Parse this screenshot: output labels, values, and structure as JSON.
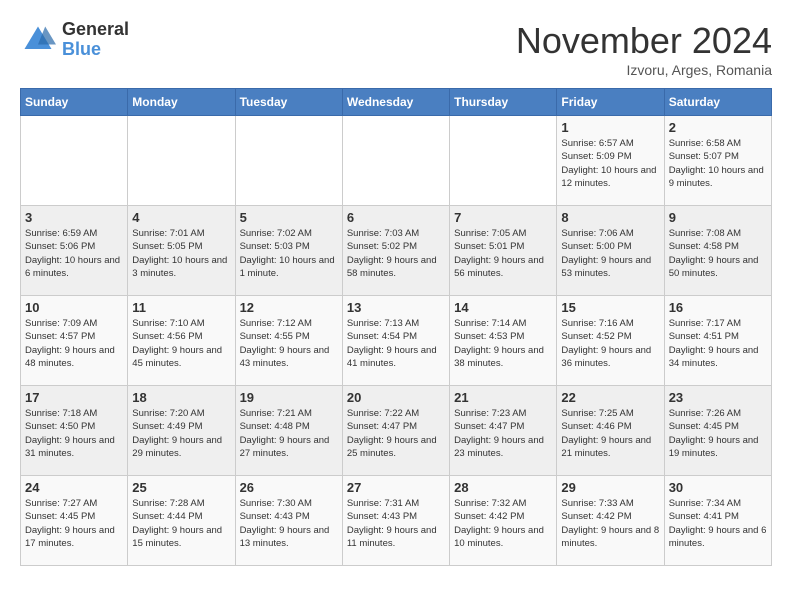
{
  "header": {
    "logo_general": "General",
    "logo_blue": "Blue",
    "month_title": "November 2024",
    "location": "Izvoru, Arges, Romania"
  },
  "days_of_week": [
    "Sunday",
    "Monday",
    "Tuesday",
    "Wednesday",
    "Thursday",
    "Friday",
    "Saturday"
  ],
  "weeks": [
    [
      {
        "day": "",
        "info": ""
      },
      {
        "day": "",
        "info": ""
      },
      {
        "day": "",
        "info": ""
      },
      {
        "day": "",
        "info": ""
      },
      {
        "day": "",
        "info": ""
      },
      {
        "day": "1",
        "info": "Sunrise: 6:57 AM\nSunset: 5:09 PM\nDaylight: 10 hours and 12 minutes."
      },
      {
        "day": "2",
        "info": "Sunrise: 6:58 AM\nSunset: 5:07 PM\nDaylight: 10 hours and 9 minutes."
      }
    ],
    [
      {
        "day": "3",
        "info": "Sunrise: 6:59 AM\nSunset: 5:06 PM\nDaylight: 10 hours and 6 minutes."
      },
      {
        "day": "4",
        "info": "Sunrise: 7:01 AM\nSunset: 5:05 PM\nDaylight: 10 hours and 3 minutes."
      },
      {
        "day": "5",
        "info": "Sunrise: 7:02 AM\nSunset: 5:03 PM\nDaylight: 10 hours and 1 minute."
      },
      {
        "day": "6",
        "info": "Sunrise: 7:03 AM\nSunset: 5:02 PM\nDaylight: 9 hours and 58 minutes."
      },
      {
        "day": "7",
        "info": "Sunrise: 7:05 AM\nSunset: 5:01 PM\nDaylight: 9 hours and 56 minutes."
      },
      {
        "day": "8",
        "info": "Sunrise: 7:06 AM\nSunset: 5:00 PM\nDaylight: 9 hours and 53 minutes."
      },
      {
        "day": "9",
        "info": "Sunrise: 7:08 AM\nSunset: 4:58 PM\nDaylight: 9 hours and 50 minutes."
      }
    ],
    [
      {
        "day": "10",
        "info": "Sunrise: 7:09 AM\nSunset: 4:57 PM\nDaylight: 9 hours and 48 minutes."
      },
      {
        "day": "11",
        "info": "Sunrise: 7:10 AM\nSunset: 4:56 PM\nDaylight: 9 hours and 45 minutes."
      },
      {
        "day": "12",
        "info": "Sunrise: 7:12 AM\nSunset: 4:55 PM\nDaylight: 9 hours and 43 minutes."
      },
      {
        "day": "13",
        "info": "Sunrise: 7:13 AM\nSunset: 4:54 PM\nDaylight: 9 hours and 41 minutes."
      },
      {
        "day": "14",
        "info": "Sunrise: 7:14 AM\nSunset: 4:53 PM\nDaylight: 9 hours and 38 minutes."
      },
      {
        "day": "15",
        "info": "Sunrise: 7:16 AM\nSunset: 4:52 PM\nDaylight: 9 hours and 36 minutes."
      },
      {
        "day": "16",
        "info": "Sunrise: 7:17 AM\nSunset: 4:51 PM\nDaylight: 9 hours and 34 minutes."
      }
    ],
    [
      {
        "day": "17",
        "info": "Sunrise: 7:18 AM\nSunset: 4:50 PM\nDaylight: 9 hours and 31 minutes."
      },
      {
        "day": "18",
        "info": "Sunrise: 7:20 AM\nSunset: 4:49 PM\nDaylight: 9 hours and 29 minutes."
      },
      {
        "day": "19",
        "info": "Sunrise: 7:21 AM\nSunset: 4:48 PM\nDaylight: 9 hours and 27 minutes."
      },
      {
        "day": "20",
        "info": "Sunrise: 7:22 AM\nSunset: 4:47 PM\nDaylight: 9 hours and 25 minutes."
      },
      {
        "day": "21",
        "info": "Sunrise: 7:23 AM\nSunset: 4:47 PM\nDaylight: 9 hours and 23 minutes."
      },
      {
        "day": "22",
        "info": "Sunrise: 7:25 AM\nSunset: 4:46 PM\nDaylight: 9 hours and 21 minutes."
      },
      {
        "day": "23",
        "info": "Sunrise: 7:26 AM\nSunset: 4:45 PM\nDaylight: 9 hours and 19 minutes."
      }
    ],
    [
      {
        "day": "24",
        "info": "Sunrise: 7:27 AM\nSunset: 4:45 PM\nDaylight: 9 hours and 17 minutes."
      },
      {
        "day": "25",
        "info": "Sunrise: 7:28 AM\nSunset: 4:44 PM\nDaylight: 9 hours and 15 minutes."
      },
      {
        "day": "26",
        "info": "Sunrise: 7:30 AM\nSunset: 4:43 PM\nDaylight: 9 hours and 13 minutes."
      },
      {
        "day": "27",
        "info": "Sunrise: 7:31 AM\nSunset: 4:43 PM\nDaylight: 9 hours and 11 minutes."
      },
      {
        "day": "28",
        "info": "Sunrise: 7:32 AM\nSunset: 4:42 PM\nDaylight: 9 hours and 10 minutes."
      },
      {
        "day": "29",
        "info": "Sunrise: 7:33 AM\nSunset: 4:42 PM\nDaylight: 9 hours and 8 minutes."
      },
      {
        "day": "30",
        "info": "Sunrise: 7:34 AM\nSunset: 4:41 PM\nDaylight: 9 hours and 6 minutes."
      }
    ]
  ]
}
